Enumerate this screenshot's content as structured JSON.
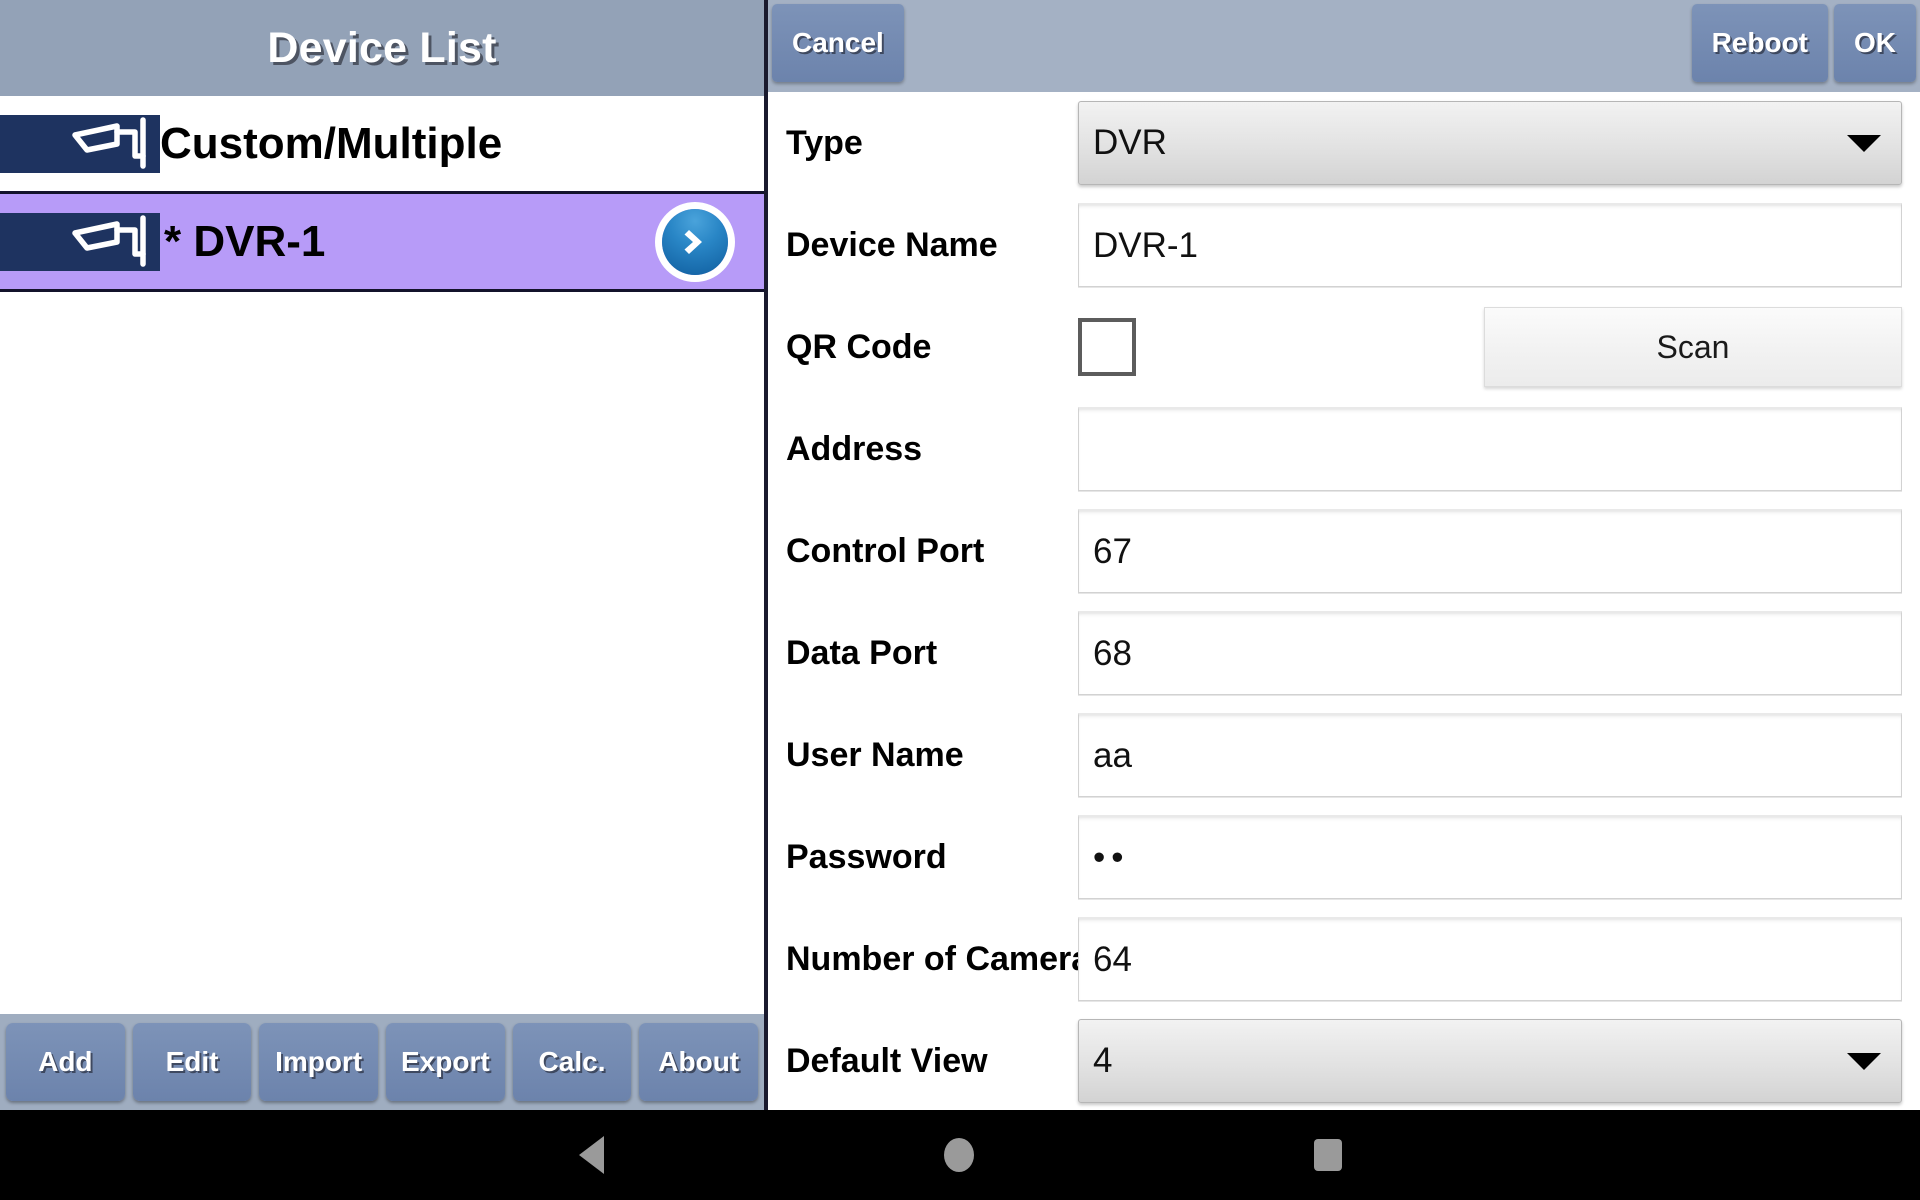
{
  "left": {
    "header": {
      "title": "Device List"
    },
    "devices": [
      {
        "label": "Custom/Multiple",
        "icon": "cctv-camera-icon",
        "selected": false,
        "has_arrow": false
      },
      {
        "label": "* DVR-1",
        "icon": "cctv-camera-icon",
        "selected": true,
        "has_arrow": true,
        "arrow_icon": "chevron-right-icon"
      }
    ],
    "toolbar": [
      {
        "label": "Add"
      },
      {
        "label": "Edit"
      },
      {
        "label": "Import"
      },
      {
        "label": "Export"
      },
      {
        "label": "Calc."
      },
      {
        "label": "About"
      }
    ]
  },
  "right": {
    "header": {
      "cancel_label": "Cancel",
      "reboot_label": "Reboot",
      "ok_label": "OK"
    },
    "form": {
      "type": {
        "label": "Type",
        "value": "DVR",
        "control": "dropdown",
        "caret_icon": "caret-down-icon"
      },
      "device_name": {
        "label": "Device Name",
        "value": "DVR-1",
        "control": "text"
      },
      "qr_code": {
        "label": "QR Code",
        "checked": false,
        "control": "checkbox",
        "scan_label": "Scan"
      },
      "address": {
        "label": "Address",
        "value": "",
        "control": "text"
      },
      "control_port": {
        "label": "Control Port",
        "value": "67",
        "control": "text"
      },
      "data_port": {
        "label": "Data Port",
        "value": "68",
        "control": "text"
      },
      "user_name": {
        "label": "User Name",
        "value": "aa",
        "control": "text"
      },
      "password": {
        "label": "Password",
        "value": "••",
        "control": "password"
      },
      "number_of_cameras": {
        "label": "Number of Cameras",
        "value": "64",
        "control": "text"
      },
      "default_view": {
        "label": "Default View",
        "value": "4",
        "control": "dropdown",
        "caret_icon": "caret-down-icon"
      }
    }
  },
  "navbar": {
    "back": "back-triangle-icon",
    "home": "home-circle-icon",
    "recents": "recents-square-icon"
  },
  "colors": {
    "header_left": "#93a2b7",
    "header_right": "#a4b1c4",
    "selected_row": "#b79bf8",
    "icon_bg": "#1e3360",
    "button_blue": "#6c83ac",
    "go_button": "#2986c6"
  }
}
